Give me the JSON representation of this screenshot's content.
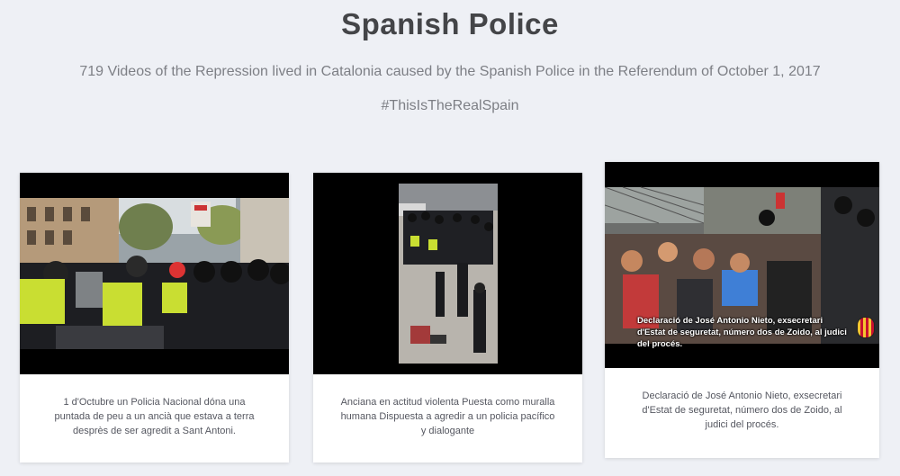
{
  "header": {
    "title": "Spanish Police",
    "subtitle": "719 Videos of the Repression lived in Catalonia caused by the Spanish Police in the Referendum of October 1, 2017",
    "hashtag": "#ThisIsTheRealSpain"
  },
  "cards": [
    {
      "caption": "1 d'Octubre un Policia Nacional dóna una puntada de peu a un ancià que estava a terra desprès de ser agredit a Sant Antoni."
    },
    {
      "caption": "Anciana en actitud violenta Puesta como muralla humana Dispuesta a agredir a un policia pacífico y dialogante"
    },
    {
      "caption": "Declaració de José Antonio Nieto, exsecretari d'Estat de seguretat, número dos de Zoido, al judici del procés.",
      "video_overlay": "Declaració de José Antonio Nieto, exsecretari d'Estat de seguretat, número dos de Zoido, al judici del procés."
    }
  ],
  "colors": {
    "background": "#eef0f5",
    "title": "#444548",
    "subtitle": "#7d7f85",
    "card": "#ffffff"
  }
}
